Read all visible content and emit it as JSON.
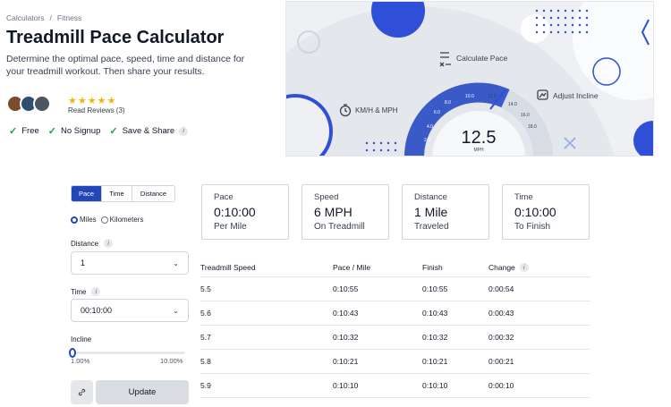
{
  "breadcrumb": {
    "items": [
      "Calculators",
      "Fitness"
    ],
    "separator": "/"
  },
  "page": {
    "title": "Treadmill Pace Calculator",
    "description": "Determine the optimal pace, speed, time and distance for your treadmill workout. Then share your results."
  },
  "reviews": {
    "stars": "★★★★★",
    "label": "Read Reviews (3)"
  },
  "features": [
    "Free",
    "No Signup",
    "Save & Share"
  ],
  "hero": {
    "calc_label": "Calculate Pace",
    "kmh_label": "KM/H & MPH",
    "incline_label": "Adjust Incline",
    "speed_value": "12.5",
    "speed_unit": "MPH",
    "gauge_ticks": [
      "2.0",
      "4.0",
      "6.0",
      "8.0",
      "10.0",
      "12.0",
      "14.0",
      "16.0",
      "18.0"
    ]
  },
  "modes": {
    "items": [
      "Pace",
      "Time",
      "Distance"
    ],
    "active": "Pace"
  },
  "units": {
    "miles": "Miles",
    "kilometers": "Kilometers"
  },
  "distance": {
    "label": "Distance",
    "value": "1"
  },
  "time": {
    "label": "Time",
    "value": "00:10:00"
  },
  "incline": {
    "label": "Incline",
    "min": "1.00%",
    "max": "10.00%",
    "level": 0
  },
  "buttons": {
    "update": "Update"
  },
  "cards": [
    {
      "label": "Pace",
      "value": "0:10:00",
      "sub": "Per Mile"
    },
    {
      "label": "Speed",
      "value": "6 MPH",
      "sub": "On Treadmill"
    },
    {
      "label": "Distance",
      "value": "1 Mile",
      "sub": "Traveled"
    },
    {
      "label": "Time",
      "value": "0:10:00",
      "sub": "To Finish"
    }
  ],
  "table": {
    "headers": [
      "Treadmill Speed",
      "Pace / Mile",
      "Finish",
      "Change"
    ],
    "rows": [
      [
        "5.5",
        "0:10:55",
        "0:10:55",
        "0:00:54"
      ],
      [
        "5.6",
        "0:10:43",
        "0:10:43",
        "0:00:43"
      ],
      [
        "5.7",
        "0:10:32",
        "0:10:32",
        "0:00:32"
      ],
      [
        "5.8",
        "0:10:21",
        "0:10:21",
        "0:00:21"
      ],
      [
        "5.9",
        "0:10:10",
        "0:10:10",
        "0:00:10"
      ]
    ]
  },
  "colors": {
    "accent": "#2346b8",
    "check": "#16a34a",
    "star": "#f5b301"
  }
}
